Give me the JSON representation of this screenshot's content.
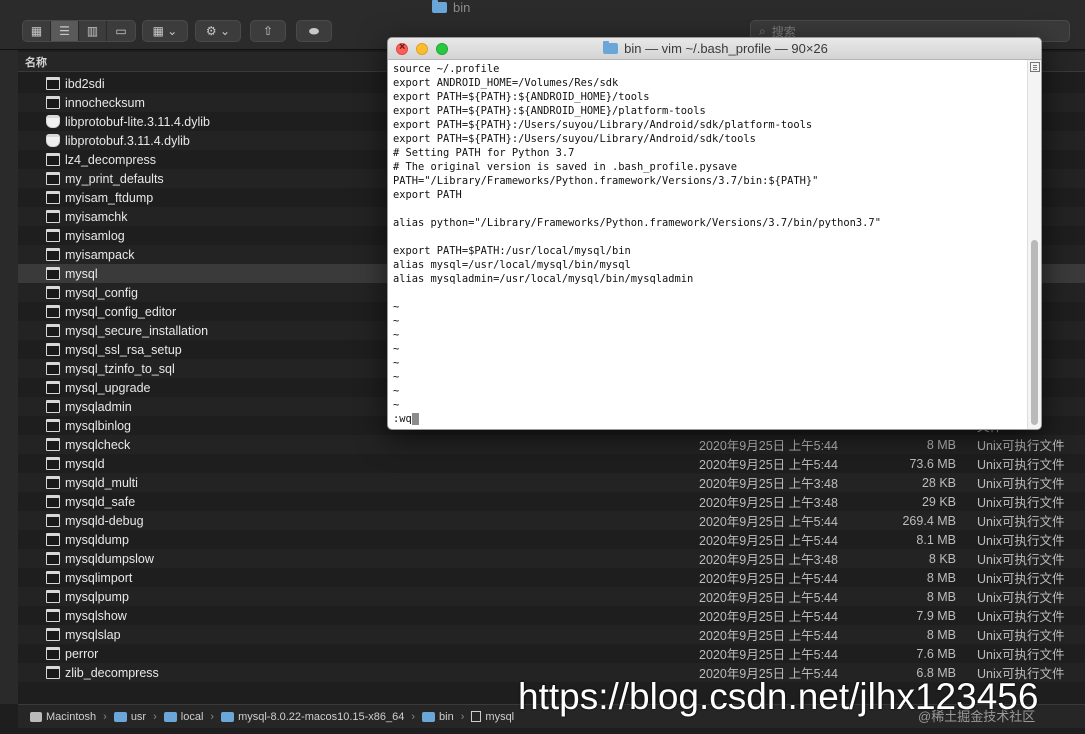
{
  "finder": {
    "window_title": "bin",
    "search_placeholder": "搜索",
    "column_name": "名称",
    "files": [
      {
        "name": "ibd2sdi",
        "date": "",
        "size": "",
        "kind": "文件",
        "icon": "exec-file-icon"
      },
      {
        "name": "innochecksum",
        "date": "",
        "size": "",
        "kind": "文件",
        "icon": "exec-file-icon"
      },
      {
        "name": "libprotobuf-lite.3.11.4.dylib",
        "date": "",
        "size": "",
        "kind": "",
        "icon": "dylib-icon"
      },
      {
        "name": "libprotobuf.3.11.4.dylib",
        "date": "",
        "size": "",
        "kind": "",
        "icon": "dylib-icon"
      },
      {
        "name": "lz4_decompress",
        "date": "",
        "size": "",
        "kind": "文件",
        "icon": "exec-file-icon"
      },
      {
        "name": "my_print_defaults",
        "date": "",
        "size": "",
        "kind": "文件",
        "icon": "exec-file-icon"
      },
      {
        "name": "myisam_ftdump",
        "date": "",
        "size": "",
        "kind": "文件",
        "icon": "exec-file-icon"
      },
      {
        "name": "myisamchk",
        "date": "",
        "size": "",
        "kind": "文件",
        "icon": "exec-file-icon"
      },
      {
        "name": "myisamlog",
        "date": "",
        "size": "",
        "kind": "文件",
        "icon": "exec-file-icon"
      },
      {
        "name": "myisampack",
        "date": "",
        "size": "",
        "kind": "文件",
        "icon": "exec-file-icon"
      },
      {
        "name": "mysql",
        "date": "",
        "size": "",
        "kind": "文件",
        "icon": "exec-file-icon",
        "selected": true
      },
      {
        "name": "mysql_config",
        "date": "",
        "size": "",
        "kind": "文件",
        "icon": "exec-file-icon"
      },
      {
        "name": "mysql_config_editor",
        "date": "",
        "size": "",
        "kind": "文件",
        "icon": "exec-file-icon"
      },
      {
        "name": "mysql_secure_installation",
        "date": "",
        "size": "",
        "kind": "文件",
        "icon": "exec-file-icon"
      },
      {
        "name": "mysql_ssl_rsa_setup",
        "date": "",
        "size": "",
        "kind": "文件",
        "icon": "exec-file-icon"
      },
      {
        "name": "mysql_tzinfo_to_sql",
        "date": "",
        "size": "",
        "kind": "文件",
        "icon": "exec-file-icon"
      },
      {
        "name": "mysql_upgrade",
        "date": "",
        "size": "",
        "kind": "文件",
        "icon": "exec-file-icon"
      },
      {
        "name": "mysqladmin",
        "date": "",
        "size": "",
        "kind": "文件",
        "icon": "exec-file-icon"
      },
      {
        "name": "mysqlbinlog",
        "date": "",
        "size": "",
        "kind": "文件",
        "icon": "exec-file-icon"
      },
      {
        "name": "mysqlcheck",
        "date": "2020年9月25日 上午5:44",
        "size": "8 MB",
        "kind": "Unix可执行文件",
        "icon": "exec-file-icon"
      },
      {
        "name": "mysqld",
        "date": "2020年9月25日 上午5:44",
        "size": "73.6 MB",
        "kind": "Unix可执行文件",
        "icon": "exec-file-icon"
      },
      {
        "name": "mysqld_multi",
        "date": "2020年9月25日 上午3:48",
        "size": "28 KB",
        "kind": "Unix可执行文件",
        "icon": "exec-file-icon"
      },
      {
        "name": "mysqld_safe",
        "date": "2020年9月25日 上午3:48",
        "size": "29 KB",
        "kind": "Unix可执行文件",
        "icon": "exec-file-icon"
      },
      {
        "name": "mysqld-debug",
        "date": "2020年9月25日 上午5:44",
        "size": "269.4 MB",
        "kind": "Unix可执行文件",
        "icon": "exec-file-icon"
      },
      {
        "name": "mysqldump",
        "date": "2020年9月25日 上午5:44",
        "size": "8.1 MB",
        "kind": "Unix可执行文件",
        "icon": "exec-file-icon"
      },
      {
        "name": "mysqldumpslow",
        "date": "2020年9月25日 上午3:48",
        "size": "8 KB",
        "kind": "Unix可执行文件",
        "icon": "exec-file-icon"
      },
      {
        "name": "mysqlimport",
        "date": "2020年9月25日 上午5:44",
        "size": "8 MB",
        "kind": "Unix可执行文件",
        "icon": "exec-file-icon"
      },
      {
        "name": "mysqlpump",
        "date": "2020年9月25日 上午5:44",
        "size": "8 MB",
        "kind": "Unix可执行文件",
        "icon": "exec-file-icon"
      },
      {
        "name": "mysqlshow",
        "date": "2020年9月25日 上午5:44",
        "size": "7.9 MB",
        "kind": "Unix可执行文件",
        "icon": "exec-file-icon"
      },
      {
        "name": "mysqlslap",
        "date": "2020年9月25日 上午5:44",
        "size": "8 MB",
        "kind": "Unix可执行文件",
        "icon": "exec-file-icon"
      },
      {
        "name": "perror",
        "date": "2020年9月25日 上午5:44",
        "size": "7.6 MB",
        "kind": "Unix可执行文件",
        "icon": "exec-file-icon"
      },
      {
        "name": "zlib_decompress",
        "date": "2020年9月25日 上午5:44",
        "size": "6.8 MB",
        "kind": "Unix可执行文件",
        "icon": "exec-file-icon"
      }
    ],
    "path": [
      "Macintosh",
      "usr",
      "local",
      "mysql-8.0.22-macos10.15-x86_64",
      "bin",
      "mysql"
    ]
  },
  "terminal": {
    "title": "bin — vim ~/.bash_profile — 90×26",
    "lines": [
      "source ~/.profile",
      "export ANDROID_HOME=/Volumes/Res/sdk",
      "export PATH=${PATH}:${ANDROID_HOME}/tools",
      "export PATH=${PATH}:${ANDROID_HOME}/platform-tools",
      "export PATH=${PATH}:/Users/suyou/Library/Android/sdk/platform-tools",
      "export PATH=${PATH}:/Users/suyou/Library/Android/sdk/tools",
      "# Setting PATH for Python 3.7",
      "# The original version is saved in .bash_profile.pysave",
      "PATH=\"/Library/Frameworks/Python.framework/Versions/3.7/bin:${PATH}\"",
      "export PATH",
      "",
      "alias python=\"/Library/Frameworks/Python.framework/Versions/3.7/bin/python3.7\"",
      "",
      "export PATH=$PATH:/usr/local/mysql/bin",
      "alias mysql=/usr/local/mysql/bin/mysql",
      "alias mysqladmin=/usr/local/mysql/bin/mysqladmin",
      "",
      "~",
      "~",
      "~",
      "~",
      "~",
      "~",
      "~",
      "~"
    ],
    "command_line": ":wq"
  },
  "watermark": {
    "url": "https://blog.csdn.net/jlhx123456",
    "sub": "@稀土掘金技术社区"
  }
}
